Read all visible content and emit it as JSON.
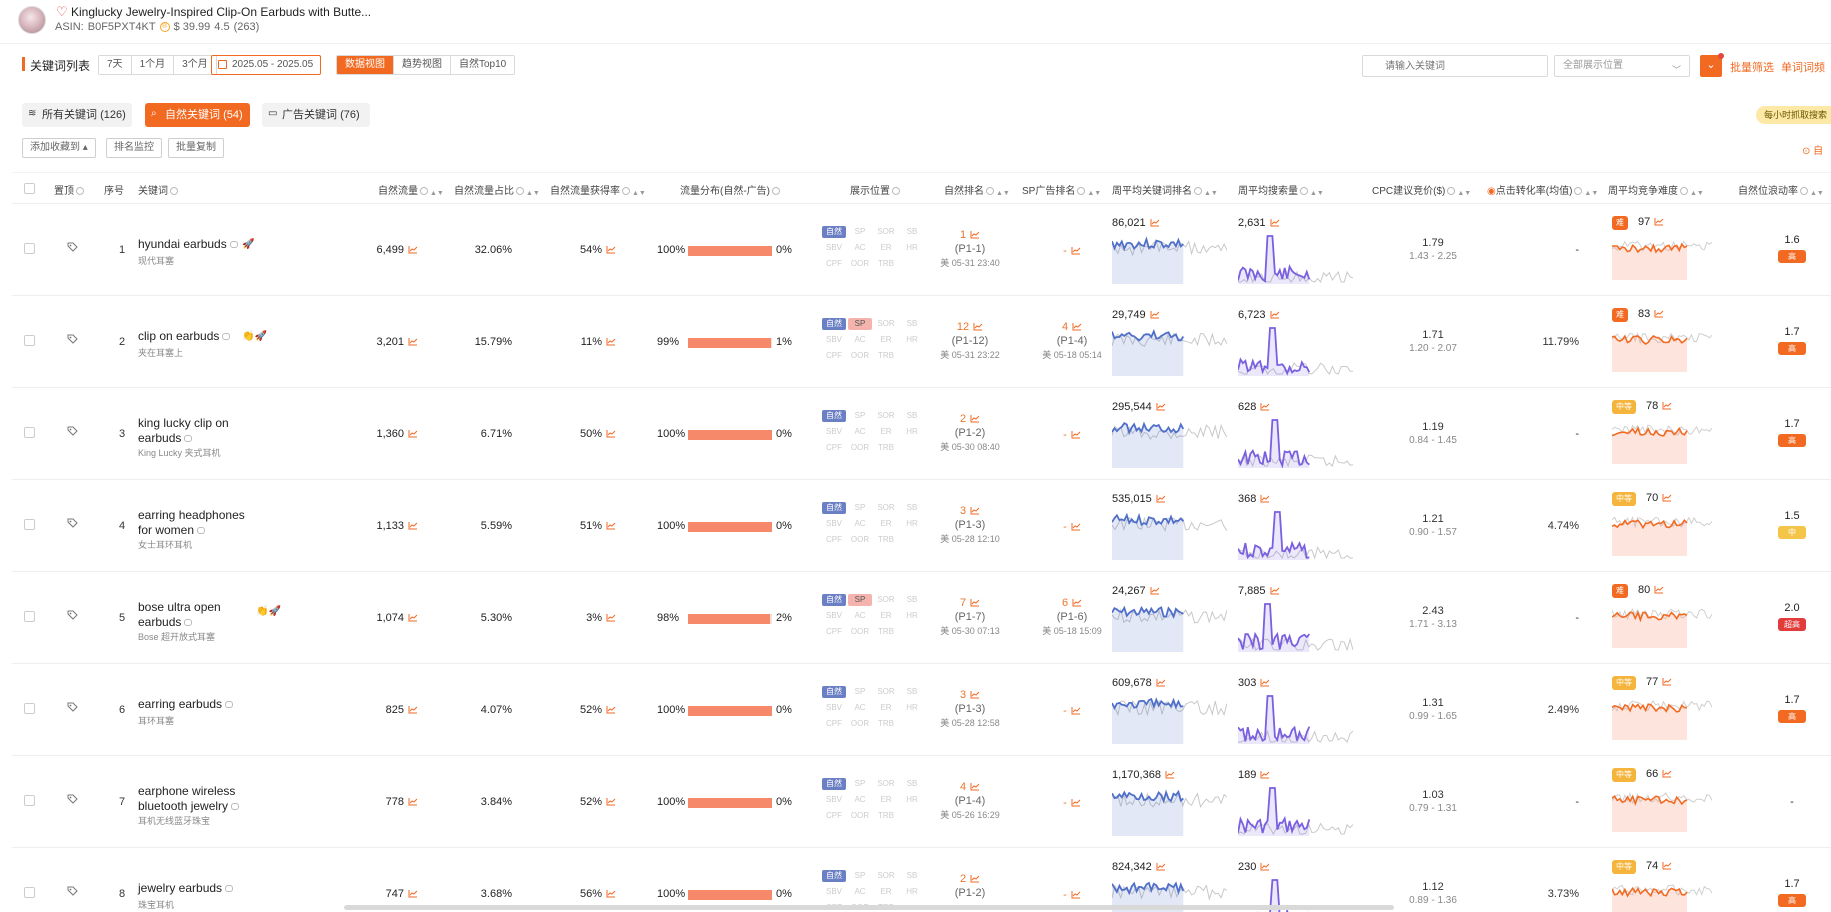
{
  "product": {
    "title": "Kinglucky Jewelry-Inspired Clip-On Earbuds with Butte...",
    "asin_label": "ASIN:",
    "asin": "B0F5PXT4KT",
    "price": "$ 39.99",
    "rating": "4.5",
    "reviews": "(263)"
  },
  "toolbar": {
    "title": "关键词列表",
    "range_options": [
      "7天",
      "1个月",
      "3个月"
    ],
    "date_range": "2025.05 - 2025.05",
    "views": [
      "数据视图",
      "趋势视图",
      "自然Top10"
    ],
    "active_view": "数据视图",
    "search_placeholder": "请输入关键词",
    "position_select": "全部展示位置",
    "batch_filter": "批量筛选",
    "single_word": "单词词频"
  },
  "tabs": [
    {
      "label": "所有关键词",
      "count": "(126)",
      "icon": "layers-icon",
      "active": false
    },
    {
      "label": "自然关键词",
      "count": "(54)",
      "icon": "search-icon",
      "active": true
    },
    {
      "label": "广告关键词",
      "count": "(76)",
      "icon": "ad-icon",
      "active": false
    }
  ],
  "hourly_badge": "每小时抓取搜索",
  "actions": {
    "add_fav": "添加收藏到",
    "rank_monitor": "排名监控",
    "batch_copy": "批量复制",
    "auto_link": "自"
  },
  "columns": {
    "pin": "置顶",
    "no": "序号",
    "keyword": "关键词",
    "natural_traffic": "自然流量",
    "natural_share": "自然流量占比",
    "natural_win": "自然流量获得率",
    "dist": "流量分布(自然-广告)",
    "display_pos": "展示位置",
    "natural_rank": "自然排名",
    "sp_rank": "SP广告排名",
    "weekly_rank": "周平均关键词排名",
    "weekly_search": "周平均搜索量",
    "cpc": "CPC建议竞价($)",
    "conv": "点击转化率(均值)",
    "weekly_comp": "周平均竞争难度",
    "scroll_rate": "自然位浪动率"
  },
  "position_labels": [
    "自然",
    "SP",
    "SOR",
    "SB",
    "SBV",
    "AC",
    "ER",
    "HR",
    "CPF",
    "OOR",
    "TRB"
  ],
  "rows": [
    {
      "no": "1",
      "kw": "hyundai earbuds",
      "sub": "现代耳塞",
      "emoji": "🚀",
      "traffic": "6,499",
      "share": "32.06%",
      "win": "54%",
      "nat": "100%",
      "ad": "0%",
      "nat_frac": 1.0,
      "pos_on": [
        0
      ],
      "rank": "1",
      "rank_p": "(P1-1)",
      "rank_t": "美 05-31 23:40",
      "sp": "-",
      "sp_p": "",
      "sp_t": "",
      "wk_rank": "86,021",
      "wk_search": "2,631",
      "cpc": "1.79",
      "cpc_r": "1.43 - 2.25",
      "conv": "-",
      "diff_tag": "难",
      "diff": "97",
      "rate": "1.6",
      "rate_tag": "高"
    },
    {
      "no": "2",
      "kw": "clip on earbuds",
      "sub": "夹在耳塞上",
      "emoji": "👏🚀",
      "traffic": "3,201",
      "share": "15.79%",
      "win": "11%",
      "nat": "99%",
      "ad": "1%",
      "nat_frac": 0.99,
      "pos_on": [
        0,
        1
      ],
      "rank": "12",
      "rank_p": "(P1-12)",
      "rank_t": "美 05-31 23:22",
      "sp": "4",
      "sp_p": "(P1-4)",
      "sp_t": "美 05-18 05:14",
      "wk_rank": "29,749",
      "wk_search": "6,723",
      "cpc": "1.71",
      "cpc_r": "1.20 - 2.07",
      "conv": "11.79%",
      "diff_tag": "难",
      "diff": "83",
      "rate": "1.7",
      "rate_tag": "高"
    },
    {
      "no": "3",
      "kw": "king lucky clip on earbuds",
      "sub": "King Lucky 夹式耳机",
      "emoji": "",
      "traffic": "1,360",
      "share": "6.71%",
      "win": "50%",
      "nat": "100%",
      "ad": "0%",
      "nat_frac": 1.0,
      "pos_on": [
        0
      ],
      "rank": "2",
      "rank_p": "(P1-2)",
      "rank_t": "美 05-30 08:40",
      "sp": "-",
      "sp_p": "",
      "sp_t": "",
      "wk_rank": "295,544",
      "wk_search": "628",
      "cpc": "1.19",
      "cpc_r": "0.84 - 1.45",
      "conv": "-",
      "diff_tag": "中等",
      "diff": "78",
      "rate": "1.7",
      "rate_tag": "高"
    },
    {
      "no": "4",
      "kw": "earring headphones for women",
      "sub": "女士耳环耳机",
      "emoji": "",
      "traffic": "1,133",
      "share": "5.59%",
      "win": "51%",
      "nat": "100%",
      "ad": "0%",
      "nat_frac": 1.0,
      "pos_on": [
        0
      ],
      "rank": "3",
      "rank_p": "(P1-3)",
      "rank_t": "美 05-28 12:10",
      "sp": "-",
      "sp_p": "",
      "sp_t": "",
      "wk_rank": "535,015",
      "wk_search": "368",
      "cpc": "1.21",
      "cpc_r": "0.90 - 1.57",
      "conv": "4.74%",
      "diff_tag": "中等",
      "diff": "70",
      "rate": "1.5",
      "rate_tag": "中"
    },
    {
      "no": "5",
      "kw": "bose ultra open earbuds",
      "sub": "Bose 超开放式耳塞",
      "emoji": "👏🚀",
      "traffic": "1,074",
      "share": "5.30%",
      "win": "3%",
      "nat": "98%",
      "ad": "2%",
      "nat_frac": 0.98,
      "pos_on": [
        0,
        1
      ],
      "rank": "7",
      "rank_p": "(P1-7)",
      "rank_t": "美 05-30 07:13",
      "sp": "6",
      "sp_p": "(P1-6)",
      "sp_t": "美 05-18 15:09",
      "wk_rank": "24,267",
      "wk_search": "7,885",
      "cpc": "2.43",
      "cpc_r": "1.71 - 3.13",
      "conv": "-",
      "diff_tag": "难",
      "diff": "80",
      "rate": "2.0",
      "rate_tag": "超高"
    },
    {
      "no": "6",
      "kw": "earring earbuds",
      "sub": "耳环耳塞",
      "emoji": "",
      "traffic": "825",
      "share": "4.07%",
      "win": "52%",
      "nat": "100%",
      "ad": "0%",
      "nat_frac": 1.0,
      "pos_on": [
        0
      ],
      "rank": "3",
      "rank_p": "(P1-3)",
      "rank_t": "美 05-28 12:58",
      "sp": "-",
      "sp_p": "",
      "sp_t": "",
      "wk_rank": "609,678",
      "wk_search": "303",
      "cpc": "1.31",
      "cpc_r": "0.99 - 1.65",
      "conv": "2.49%",
      "diff_tag": "中等",
      "diff": "77",
      "rate": "1.7",
      "rate_tag": "高"
    },
    {
      "no": "7",
      "kw": "earphone wireless bluetooth jewelry",
      "sub": "耳机无线蓝牙珠宝",
      "emoji": "",
      "traffic": "778",
      "share": "3.84%",
      "win": "52%",
      "nat": "100%",
      "ad": "0%",
      "nat_frac": 1.0,
      "pos_on": [
        0
      ],
      "rank": "4",
      "rank_p": "(P1-4)",
      "rank_t": "美 05-26 16:29",
      "sp": "-",
      "sp_p": "",
      "sp_t": "",
      "wk_rank": "1,170,368",
      "wk_search": "189",
      "cpc": "1.03",
      "cpc_r": "0.79 - 1.31",
      "conv": "-",
      "diff_tag": "中等",
      "diff": "66",
      "rate": "-",
      "rate_tag": ""
    },
    {
      "no": "8",
      "kw": "jewelry earbuds",
      "sub": "珠宝耳机",
      "emoji": "",
      "traffic": "747",
      "share": "3.68%",
      "win": "56%",
      "nat": "100%",
      "ad": "0%",
      "nat_frac": 1.0,
      "pos_on": [
        0
      ],
      "rank": "2",
      "rank_p": "(P1-2)",
      "rank_t": "",
      "sp": "-",
      "sp_p": "",
      "sp_t": "",
      "wk_rank": "824,342",
      "wk_search": "230",
      "cpc": "1.12",
      "cpc_r": "0.89 - 1.36",
      "conv": "3.73%",
      "diff_tag": "中等",
      "diff": "74",
      "rate": "1.7",
      "rate_tag": "高"
    }
  ],
  "colors": {
    "accent": "#f26a21",
    "bar": "#f5896a",
    "blue_line": "#4f6fc9",
    "purple_line": "#7a5fe0",
    "hard": "#f26a21",
    "mid": "#f5b43c",
    "high": "#f26a21",
    "midrate": "#f5c54a",
    "ultra": "#e23b3b"
  }
}
